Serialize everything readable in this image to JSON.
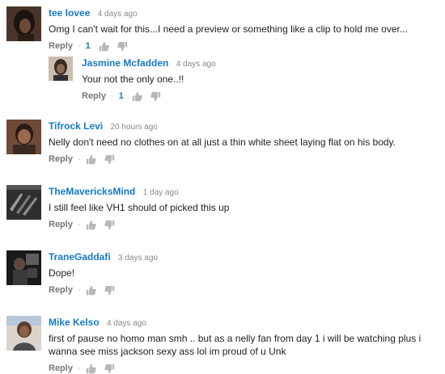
{
  "comments": [
    {
      "author": "tee lovee",
      "time": "4 days ago",
      "text": "Omg I can't wait for this...I need a preview or something like a clip to hold me over...",
      "reply_label": "Reply",
      "dot": "·",
      "likes": "1"
    },
    {
      "author": "Jasmine Mcfadden",
      "time": "4 days ago",
      "text": "Your not the only one..!!",
      "reply_label": "Reply",
      "dot": "·",
      "likes": "1"
    },
    {
      "author": "Tifrock Levi",
      "time": "20 hours ago",
      "text": "Nelly  don't need no clothes on at all just a thin white sheet laying flat on his body.",
      "reply_label": "Reply",
      "dot": "·",
      "likes": ""
    },
    {
      "author": "TheMavericksMind",
      "time": "1 day ago",
      "text": "I still feel like VH1 should of picked this up",
      "reply_label": "Reply",
      "dot": "·",
      "likes": ""
    },
    {
      "author": "TraneGaddafi",
      "time": "3 days ago",
      "text": "Dope!",
      "reply_label": "Reply",
      "dot": "·",
      "likes": ""
    },
    {
      "author": "Mike Kelso",
      "time": "4 days ago",
      "text": "first of pause no homo man smh .. but as a nelly fan from day 1 i will be watching plus i wanna see miss jackson sexy ass lol im proud of u Unk",
      "reply_label": "Reply",
      "dot": "·",
      "likes": ""
    }
  ],
  "icons": {
    "like": "thumbs-up-icon",
    "dislike": "thumbs-down-icon"
  },
  "colors": {
    "author": "#167ac6",
    "time": "#8a8a8a",
    "text": "#222222",
    "reply": "#767676",
    "icon": "#b8b8b8"
  }
}
